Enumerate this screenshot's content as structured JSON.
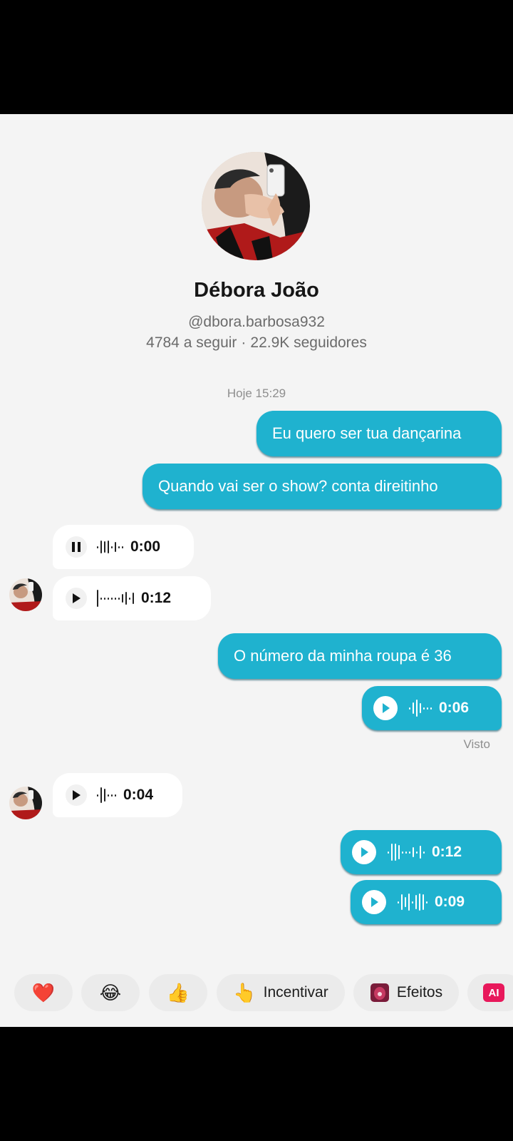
{
  "profile": {
    "name": "Débora João",
    "handle": "@dbora.barbosa932",
    "following": "4784 a seguir",
    "separator": "·",
    "followers": "22.9K seguidores"
  },
  "timestamp": "Hoje 15:29",
  "messages": {
    "out1": "Eu quero ser tua dançarina",
    "out2": "Quando vai ser o show? conta direitinho",
    "in_voice1_duration": "0:00",
    "in_voice2_duration": "0:12",
    "out3": "O número da minha roupa é 36",
    "out_voice1_duration": "0:06",
    "seen": "Visto",
    "in_voice3_duration": "0:04",
    "out_voice2_duration": "0:12",
    "out_voice3_duration": "0:09"
  },
  "quick_replies": {
    "heart": "❤️",
    "laugh": "😂",
    "thumbs": "👍",
    "incentivar_emoji": "👆",
    "incentivar": "Incentivar",
    "efeitos": "Efeitos",
    "ai": "AI"
  },
  "colors": {
    "outgoing_bubble": "#1fb2cf",
    "incoming_bubble": "#ffffff",
    "background": "#f4f4f4",
    "ai_badge": "#e8185b"
  },
  "icons": [
    "play-icon",
    "pause-icon",
    "waveform-icon",
    "heart-emoji",
    "laugh-emoji",
    "thumbs-up-emoji",
    "pointing-emoji",
    "effects-icon",
    "ai-icon"
  ]
}
